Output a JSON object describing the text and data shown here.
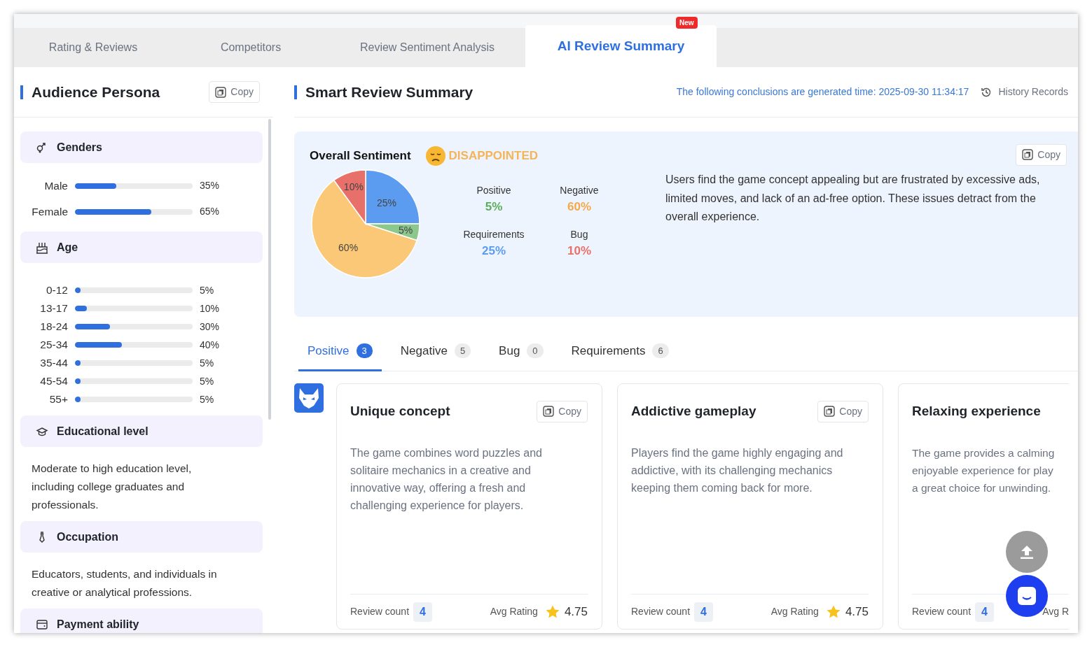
{
  "tabs": [
    {
      "label": "Rating & Reviews",
      "selected": false
    },
    {
      "label": "Competitors",
      "selected": false
    },
    {
      "label": "Review Sentiment Analysis",
      "selected": false
    },
    {
      "label": "AI Review Summary",
      "selected": true,
      "badge": "New"
    }
  ],
  "persona": {
    "title": "Audience Persona",
    "copy": "Copy",
    "sections": [
      {
        "kind": "bars",
        "title": "Genders",
        "rows": [
          {
            "label": "Male",
            "level": 0.35,
            "reading": "35%"
          },
          {
            "label": "Female",
            "level": 0.65,
            "reading": "65%"
          }
        ]
      },
      {
        "kind": "bars",
        "title": "Age",
        "rows": [
          {
            "label": "0-12",
            "level": 0.05,
            "reading": "5%"
          },
          {
            "label": "13-17",
            "level": 0.1,
            "reading": "10%"
          },
          {
            "label": "18-24",
            "level": 0.3,
            "reading": "30%"
          },
          {
            "label": "25-34",
            "level": 0.4,
            "reading": "40%"
          },
          {
            "label": "35-44",
            "level": 0.05,
            "reading": "5%"
          },
          {
            "label": "45-54",
            "level": 0.05,
            "reading": "5%"
          },
          {
            "label": "55+",
            "level": 0.05,
            "reading": "5%"
          }
        ]
      },
      {
        "kind": "text",
        "title": "Educational level",
        "text": "Moderate to high education level, including college graduates and professionals."
      },
      {
        "kind": "text",
        "title": "Occupation",
        "text": "Educators, students, and individuals in creative or analytical professions."
      },
      {
        "kind": "text",
        "title": "Payment ability"
      }
    ]
  },
  "summary": {
    "title": "Smart Review Summary",
    "generated": "The following conclusions are generated time: 2025-09-30 11:34:17",
    "history": "History Records",
    "sentiment": {
      "title": "Overall Sentiment",
      "mood": "DISAPPOINTED",
      "copy": "Copy",
      "text": "Users find the game concept appealing but are frustrated by excessive ads, limited moves, and lack of an ad-free option. These issues detract from the overall experience.",
      "chart_data": {
        "type": "pie",
        "values": [
          25,
          5,
          60,
          10
        ],
        "colors": [
          "#5b9cf0",
          "#8cc78c",
          "#fbc878",
          "#e8706a"
        ],
        "value_labels": [
          "25%",
          "5%",
          "60%",
          "10%"
        ]
      },
      "stats": [
        {
          "label": "Positive",
          "value": "5%",
          "color": "#5aae5a"
        },
        {
          "label": "Negative",
          "value": "60%",
          "color": "#f5a94a"
        },
        {
          "label": "Requirements",
          "value": "25%",
          "color": "#5b9cf0"
        },
        {
          "label": "Bug",
          "value": "10%",
          "color": "#e8706a"
        }
      ]
    },
    "subtabs": [
      {
        "label": "Positive",
        "count": "3",
        "selected": true
      },
      {
        "label": "Negative",
        "count": "5",
        "selected": false
      },
      {
        "label": "Bug",
        "count": "0",
        "selected": false
      },
      {
        "label": "Requirements",
        "count": "6",
        "selected": false
      }
    ],
    "cards": [
      {
        "title": "Unique concept",
        "copy": "Copy",
        "text": "The game combines word puzzles and solitaire mechanics in a creative and innovative way, offering a fresh and challenging experience for players.",
        "count_label": "Review count",
        "count": "4",
        "avg_label": "Avg Rating",
        "rating": "4.75"
      },
      {
        "title": "Addictive gameplay",
        "copy": "Copy",
        "text": "Players find the game highly engaging and addictive, with its challenging mechanics keeping them coming back for more.",
        "count_label": "Review count",
        "count": "4",
        "avg_label": "Avg Rating",
        "rating": "4.75"
      },
      {
        "title": "Relaxing experience",
        "lines": [
          "The game provides a calming",
          "enjoyable experience for play",
          "a great choice for unwinding."
        ],
        "count_label": "Review count",
        "count": "4",
        "avg_label": "Avg R"
      }
    ]
  }
}
